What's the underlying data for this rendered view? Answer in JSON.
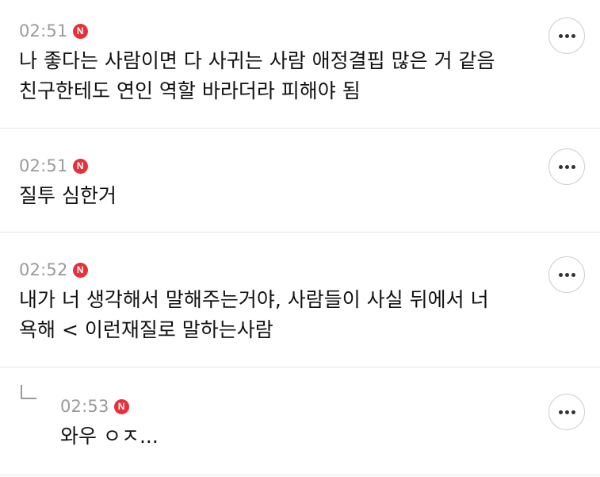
{
  "comments": [
    {
      "time": "02:51",
      "badge": "N",
      "text": "나 좋다는 사람이면 다 사귀는 사람 애정결핍 많은 거 같음\n친구한테도 연인 역할 바라더라 피해야 됨",
      "more_icon": "more-horizontal-icon"
    },
    {
      "time": "02:51",
      "badge": "N",
      "text": "질투 심한거",
      "more_icon": "more-horizontal-icon"
    },
    {
      "time": "02:52",
      "badge": "N",
      "text": "내가 너 생각해서 말해주는거야, 사람들이 사실 뒤에서 너\n욕해 < 이런재질로 말하는사람",
      "more_icon": "more-horizontal-icon"
    },
    {
      "time": "02:53",
      "badge": "N",
      "text": "와우 ㅇㅈ...",
      "is_reply": true,
      "reply_icon": "reply-arrow-icon",
      "more_icon": "more-horizontal-icon"
    }
  ],
  "colors": {
    "badge": "#e8303b",
    "time": "#9a9a9a",
    "text": "#111111",
    "divider": "#e6e6e6"
  }
}
